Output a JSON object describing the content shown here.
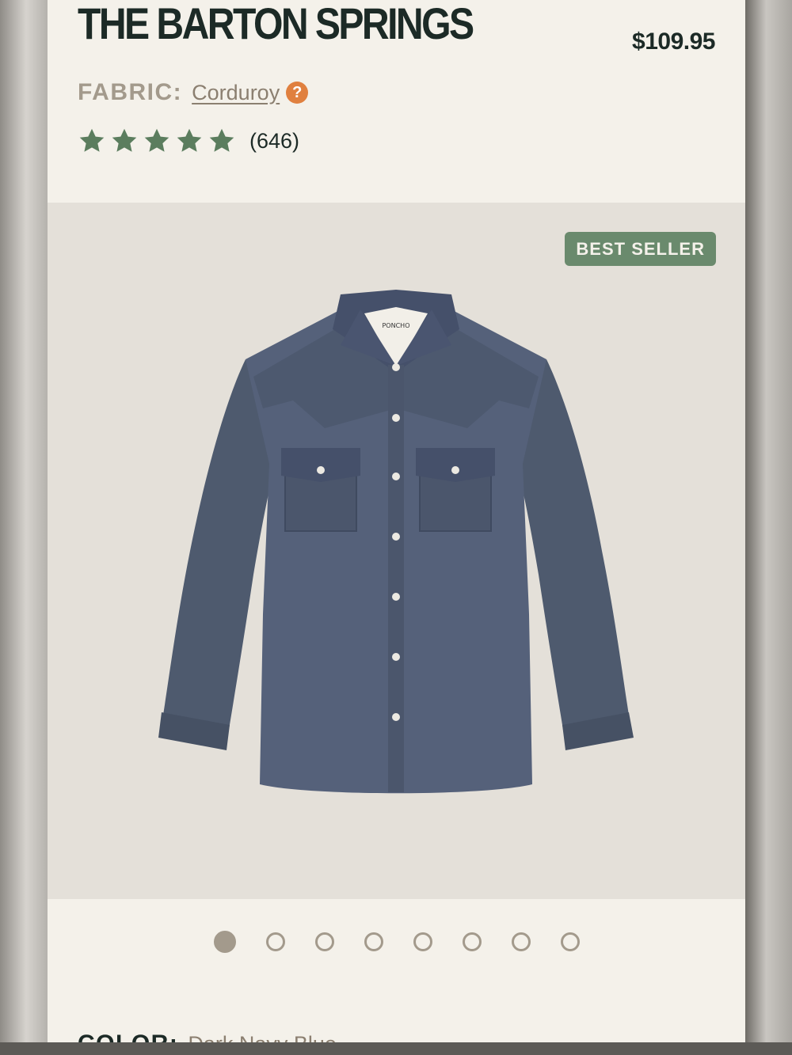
{
  "product": {
    "title": "THE BARTON SPRINGS",
    "price": "$109.95",
    "fabric_label": "FABRIC:",
    "fabric_value": "Corduroy",
    "help_glyph": "?",
    "rating_stars": 5,
    "review_count": "(646)",
    "badge": "BEST SELLER",
    "shirt_label": "PONCHO"
  },
  "carousel": {
    "total_slides": 8,
    "active_index": 0
  },
  "color": {
    "label": "COLOR:",
    "value": "Dark Navy Blue"
  },
  "colors": {
    "star": "#5b7d5e",
    "badge_bg": "#6a8a6d",
    "help_icon": "#e0803f",
    "shirt": "#4e5a6e",
    "title": "#1c2a26"
  },
  "icons": {
    "help": "question-circle-icon",
    "star": "star-icon"
  }
}
